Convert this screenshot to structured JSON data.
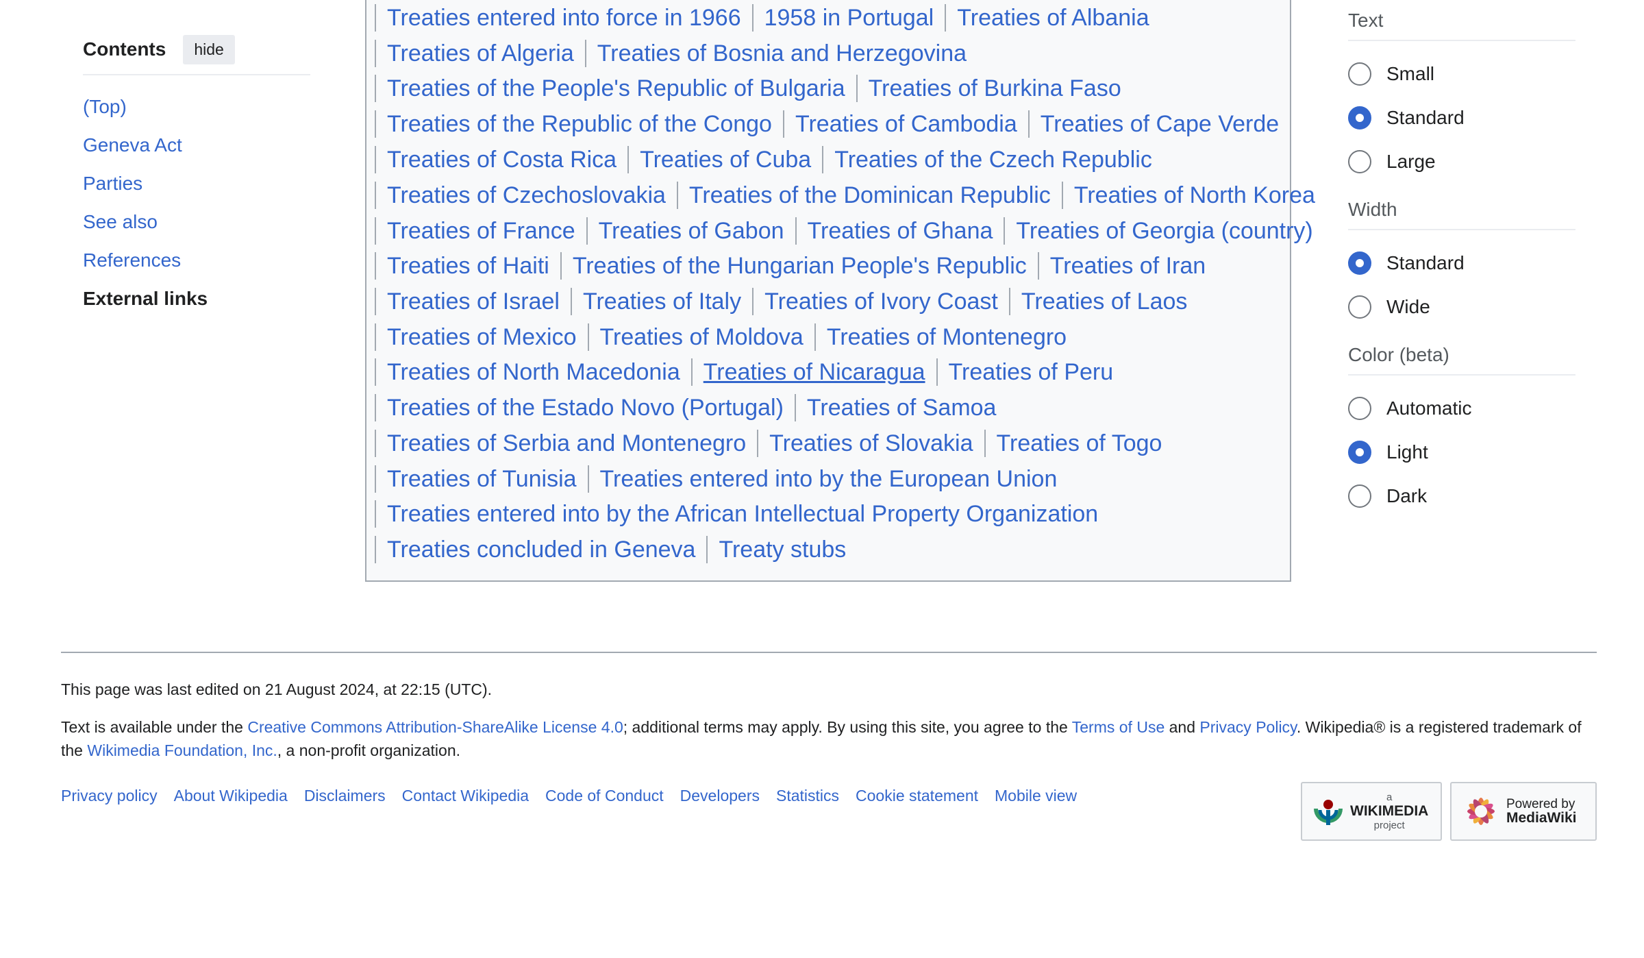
{
  "toc": {
    "title": "Contents",
    "hide_label": "hide",
    "items": [
      {
        "label": "(Top)"
      },
      {
        "label": "Geneva Act"
      },
      {
        "label": "Parties"
      },
      {
        "label": "See also"
      },
      {
        "label": "References"
      },
      {
        "label": "External links"
      }
    ]
  },
  "categories": {
    "rows": [
      [
        "Treaties entered into force in 1966",
        "1958 in Portugal",
        "Treaties of Albania"
      ],
      [
        "Treaties of Algeria",
        "Treaties of Bosnia and Herzegovina"
      ],
      [
        "Treaties of the People's Republic of Bulgaria",
        "Treaties of Burkina Faso"
      ],
      [
        "Treaties of the Republic of the Congo",
        "Treaties of Cambodia",
        "Treaties of Cape Verde"
      ],
      [
        "Treaties of Costa Rica",
        "Treaties of Cuba",
        "Treaties of the Czech Republic"
      ],
      [
        "Treaties of Czechoslovakia",
        "Treaties of the Dominican Republic",
        "Treaties of North Korea"
      ],
      [
        "Treaties of France",
        "Treaties of Gabon",
        "Treaties of Ghana",
        "Treaties of Georgia (country)"
      ],
      [
        "Treaties of Haiti",
        "Treaties of the Hungarian People's Republic",
        "Treaties of Iran"
      ],
      [
        "Treaties of Israel",
        "Treaties of Italy",
        "Treaties of Ivory Coast",
        "Treaties of Laos"
      ],
      [
        "Treaties of Mexico",
        "Treaties of Moldova",
        "Treaties of Montenegro"
      ],
      [
        "Treaties of North Macedonia",
        "Treaties of Nicaragua",
        "Treaties of Peru"
      ],
      [
        "Treaties of the Estado Novo (Portugal)",
        "Treaties of Samoa"
      ],
      [
        "Treaties of Serbia and Montenegro",
        "Treaties of Slovakia",
        "Treaties of Togo"
      ],
      [
        "Treaties of Tunisia",
        "Treaties entered into by the European Union"
      ],
      [
        "Treaties entered into by the African Intellectual Property Organization"
      ],
      [
        "Treaties concluded in Geneva",
        "Treaty stubs"
      ]
    ],
    "hovered": "Treaties of Nicaragua"
  },
  "appearance": {
    "text": {
      "title": "Text",
      "options": [
        "Small",
        "Standard",
        "Large"
      ],
      "selected": "Standard"
    },
    "width": {
      "title": "Width",
      "options": [
        "Standard",
        "Wide"
      ],
      "selected": "Standard"
    },
    "color": {
      "title": "Color (beta)",
      "options": [
        "Automatic",
        "Light",
        "Dark"
      ],
      "selected": "Light"
    }
  },
  "footer": {
    "last_edited": "This page was last edited on 21 August 2024, at 22:15 (UTC).",
    "license_prefix": "Text is available under the ",
    "license_link": "Creative Commons Attribution-ShareAlike License 4.0",
    "license_mid": "; additional terms may apply. By using this site, you agree to the ",
    "terms_link": "Terms of Use",
    "and": " and ",
    "privacy_link": "Privacy Policy",
    "license_suffix": ". Wikipedia® is a registered trademark of the ",
    "foundation_link": "Wikimedia Foundation, Inc.",
    "license_end": ", a non-profit organization.",
    "links": [
      "Privacy policy",
      "About Wikipedia",
      "Disclaimers",
      "Contact Wikipedia",
      "Code of Conduct",
      "Developers",
      "Statistics",
      "Cookie statement",
      "Mobile view"
    ],
    "badge_wikimedia": {
      "top": "a",
      "name": "WIKIMEDIA",
      "bottom": "project"
    },
    "badge_mediawiki": {
      "line1": "Powered by",
      "line2": "MediaWiki"
    }
  },
  "colors": {
    "link": "#3366cc",
    "radio_selected": "#3366cc",
    "box_bg": "#f8f9fa"
  }
}
